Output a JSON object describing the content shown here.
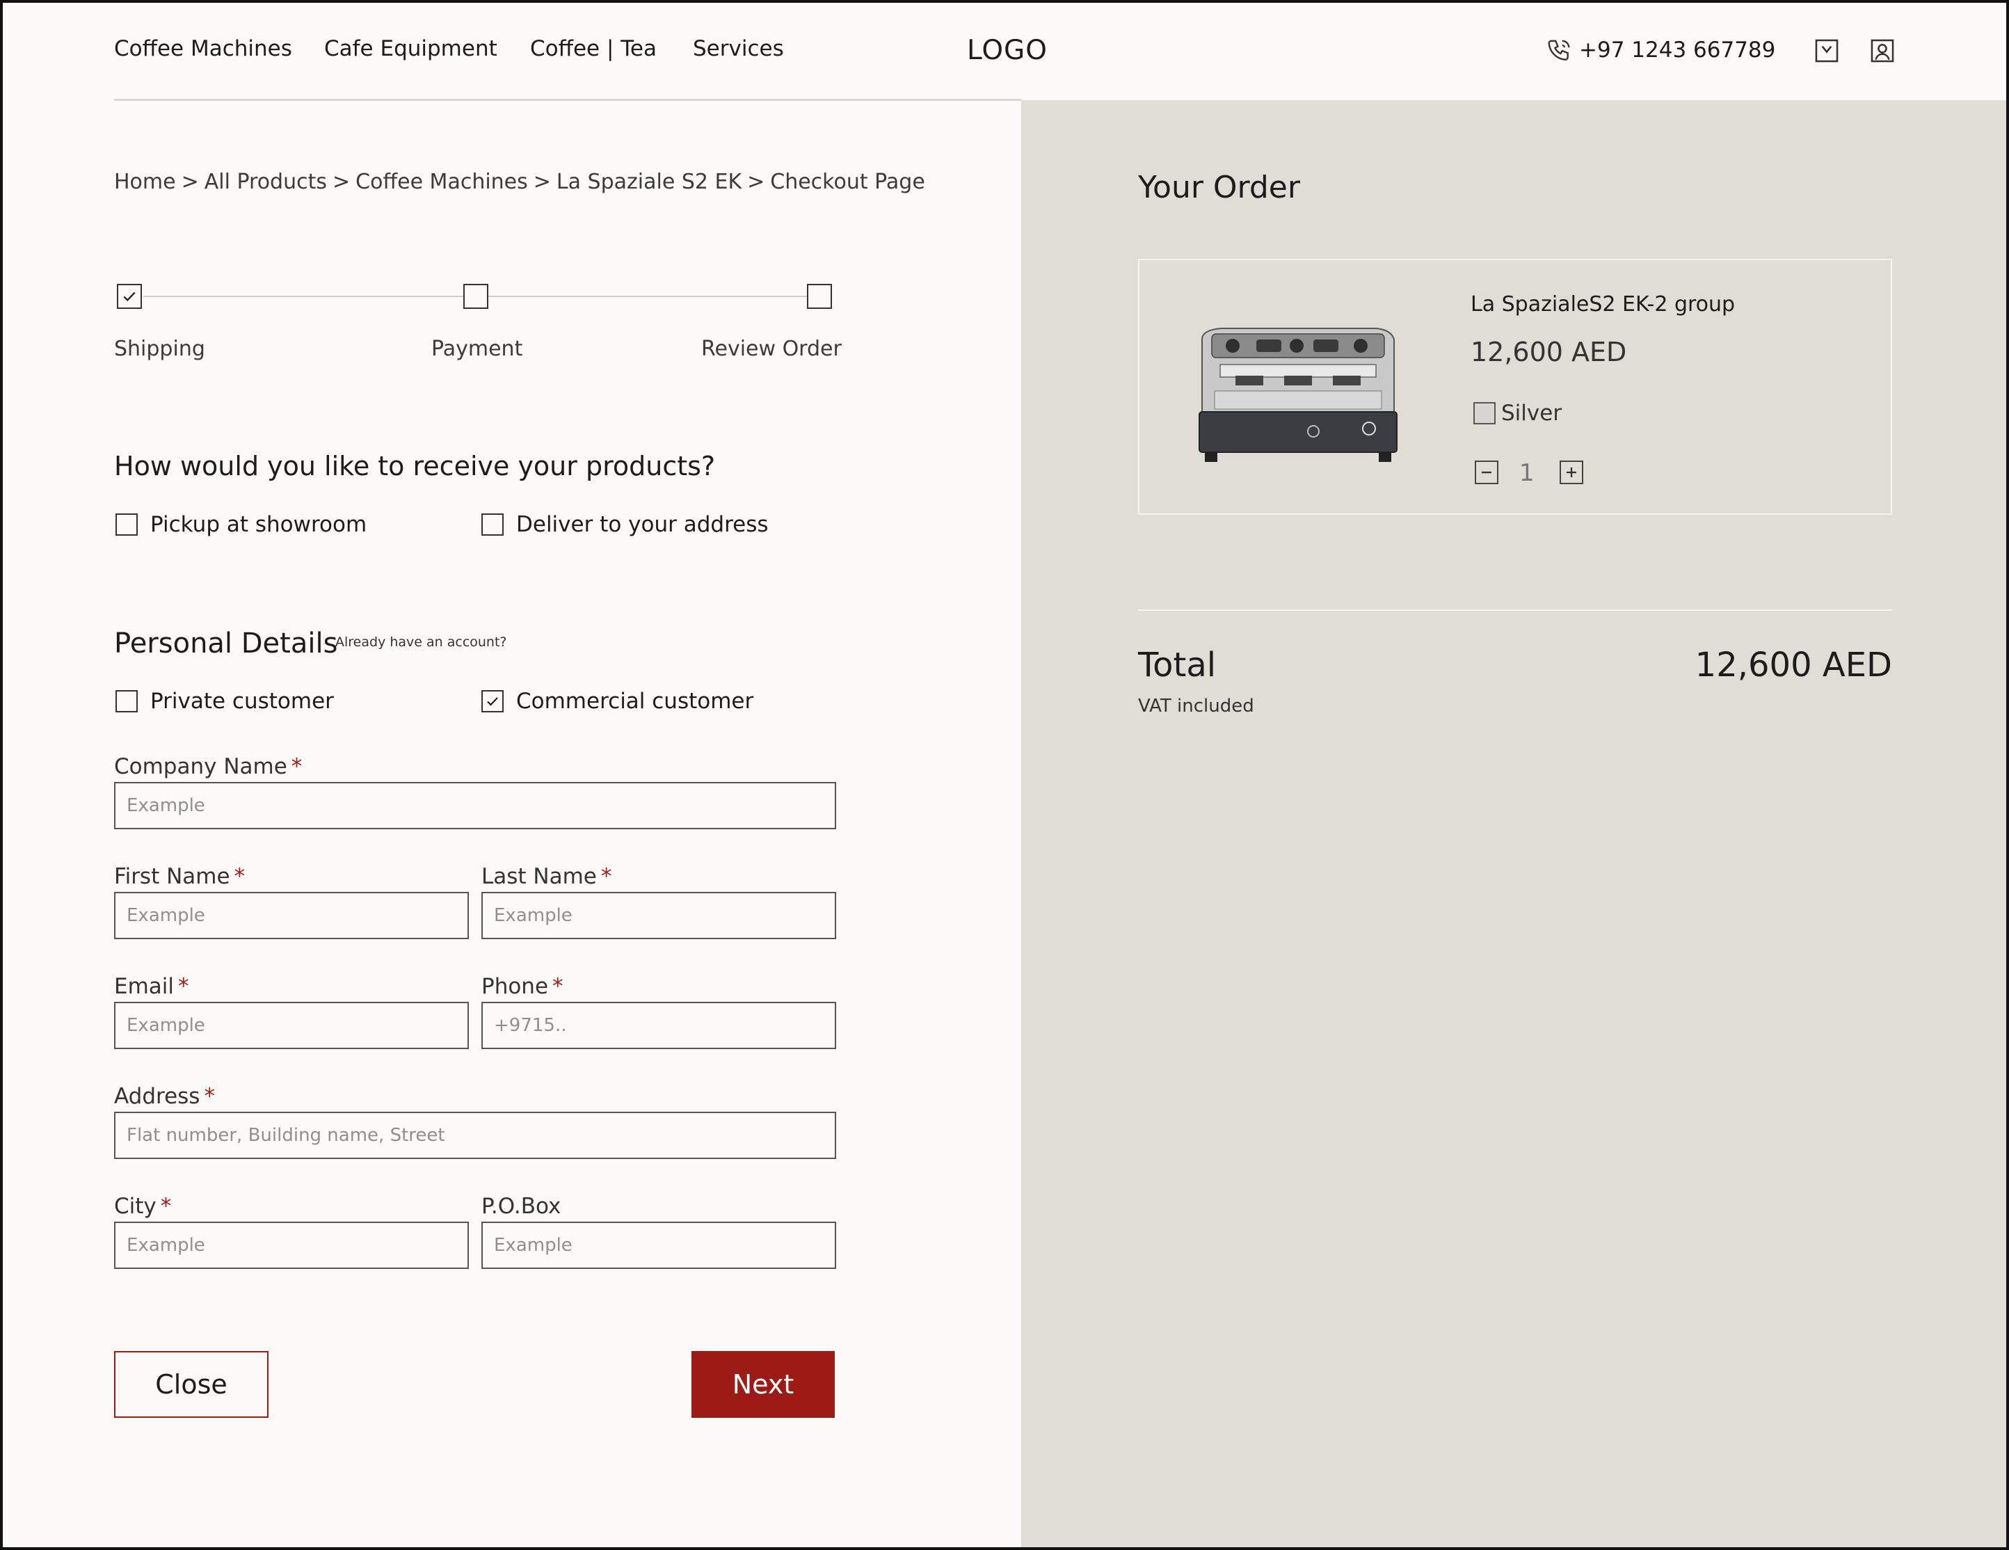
{
  "header": {
    "nav": [
      "Coffee Machines",
      "Cafe Equipment",
      "Coffee | Tea",
      "Services"
    ],
    "logo": "LOGO",
    "phone": "+97 1243 667789",
    "icons": [
      "phone-icon",
      "cart-icon",
      "user-icon"
    ]
  },
  "breadcrumb": [
    "Home",
    "All Products",
    "Coffee Machines",
    "La Spaziale S2 EK",
    "Checkout Page"
  ],
  "breadcrumb_separator": ">",
  "steps": [
    {
      "label": "Shipping",
      "checked": true
    },
    {
      "label": "Payment",
      "checked": false
    },
    {
      "label": "Review Order",
      "checked": false
    }
  ],
  "delivery": {
    "question": "How would you like to receive your products?",
    "options": [
      {
        "label": "Pickup at showroom",
        "checked": false
      },
      {
        "label": "Deliver to your address",
        "checked": false
      }
    ]
  },
  "personal": {
    "title": "Personal Details",
    "account_link": "Already have an account?",
    "customer_types": [
      {
        "label": "Private customer",
        "checked": false
      },
      {
        "label": "Commercial customer",
        "checked": true
      }
    ]
  },
  "form": {
    "required_mark": "*",
    "company": {
      "label": "Company Name",
      "placeholder": "Example",
      "required": true
    },
    "first_name": {
      "label": "First Name",
      "placeholder": "Example",
      "required": true
    },
    "last_name": {
      "label": "Last Name",
      "placeholder": "Example",
      "required": true
    },
    "email": {
      "label": "Email",
      "placeholder": "Example",
      "required": true
    },
    "phone": {
      "label": "Phone",
      "placeholder": "+9715..",
      "required": true
    },
    "address": {
      "label": "Address",
      "placeholder": "Flat number, Building name, Street",
      "required": true
    },
    "city": {
      "label": "City",
      "placeholder": "Example",
      "required": true
    },
    "pobox": {
      "label": "P.O.Box",
      "placeholder": "Example",
      "required": false
    }
  },
  "buttons": {
    "close": "Close",
    "next": "Next"
  },
  "order": {
    "title": "Your Order",
    "item": {
      "name": "La SpazialeS2 EK-2 group",
      "price": "12,600 AED",
      "color": "Silver",
      "quantity": "1",
      "image_icon": "espresso-machine-image"
    },
    "total_label": "Total",
    "total_value": "12,600 AED",
    "vat_note": "VAT included"
  },
  "colors": {
    "accent": "#9e1a14",
    "required": "#a31b14",
    "panel_bg": "#e0dcd6",
    "page_bg": "#fbfaf8"
  }
}
